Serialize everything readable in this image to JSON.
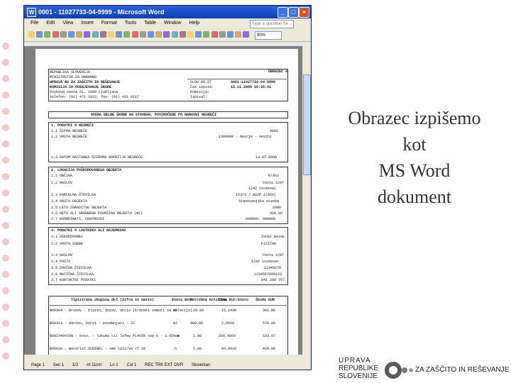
{
  "window": {
    "title": "0001 - 11027733-04-9999 - Microsoft Word",
    "word_icon": "W",
    "controls": [
      "_",
      "□",
      "×"
    ]
  },
  "menu": {
    "items": [
      "File",
      "Edit",
      "View",
      "Insert",
      "Format",
      "Tools",
      "Table",
      "Window",
      "Help"
    ],
    "ask_placeholder": "Type a question for help"
  },
  "toolbar": {
    "zoom": "90%"
  },
  "status": {
    "page": "Page 1",
    "sec": "Sec 1",
    "pages": "1/2",
    "at": "At 11cm",
    "ln": "Ln 1",
    "col": "Col 1",
    "flags": "REC TRK EXT OVR",
    "language": "Slovenian"
  },
  "document": {
    "header_lines": [
      "REPUBLIKA SLOVENIJA",
      "MINISTRSTVO ZA OBRAMBO",
      "UPRAVA RS ZA ZAŠČITO IN REŠEVANJE",
      "KOMISIJA ZA OCENJEVANJE ŠKODE",
      "Vojkova cesta 61, 1000 Ljubljana",
      "telefon: (01) 471 3322, fax: (01) 431 8117"
    ],
    "form_code": "OBRAZEC 4",
    "meta_labels": [
      "SLOG 05:57",
      "Čas izpisa:",
      "Komisija:",
      "Izpisal:"
    ],
    "meta_values": [
      "0001-11027733-04-9999",
      "15.11.2008 16:35:41"
    ],
    "main_title": "OCENA DELNE ŠKODE NA STAVBAH, POVZROČENE PO NARAVNI NESREČI",
    "sec1_title": "1. PODATKI O NESREČI",
    "sec1_rows": [
      "1.1 ŠIFRA NESREČE",
      "1.2 VRSTA NESREČE",
      "1.3 DATUM NASTANKA OZIROMA ODKRITJA NESREČE"
    ],
    "sec1_values": [
      "0001",
      "1300000 - Neurje - neviht",
      "13.07.2008"
    ],
    "sec2_title": "2. LOKACIJA POŠKODOVANEGA OBJEKTA",
    "sec2_rows": [
      "2.1 OBČINA",
      "2.2 NASLOV",
      "2.3 PARCELNA ŠTEVILKA",
      "2.4 VRSTA OBJEKTA",
      "2.5 LETO ZGRADITVE OBJEKTA",
      "2.6 NETO ALI GRADBENA POVRŠINA OBJEKTA (m2)",
      "2.7 KOORDINATI, CENTROIDI"
    ],
    "sec2_values": [
      "Krško",
      "Cesta 1C07",
      "1242 Stoževec",
      "153/3 / SDZP 1(859)",
      "Stanovanjska stavba",
      "2000",
      "420.00",
      "000000, 000000"
    ],
    "sec3_title": "3. PODATKI O LASTNIKU ALI NAJEMNIKU",
    "sec3_rows": [
      "3.1 OŠKODOVANEC",
      "3.2 VRSTA OSEBE",
      "3.3 NASLOV",
      "3.4 POŠTA",
      "3.5 DAVČNA ŠTEVILKA",
      "3.6 MATIČNA ŠTEVILKA",
      "3.7 KONTAKTNI PODATKI"
    ],
    "sec3_values": [
      "Ženez Bevak",
      "FIZIČNA",
      "Cesta 1C07",
      "1242 Stoževec",
      "12345678",
      "1234567890123",
      "041 200 707"
    ],
    "table_headers": [
      "Tipizirana skupina del (šifra in naziv)",
      "Enota mere",
      "Potrebna količina",
      "Cena Eur/enoto",
      "Škoda EUR"
    ],
    "table_rows": [
      {
        "desc": "BO0304 - Brusov - blazin, duzav, akcio (kronski zemoči na dolociju)",
        "unit": "m2",
        "qty": "20.00",
        "price": "15,1430",
        "dmg": "302.86"
      },
      {
        "desc": "BO0313 - darovo, borvi - posdanjati - ZC",
        "unit": "m2",
        "qty": "800.00",
        "price": "2,0910",
        "dmg": "570.00"
      },
      {
        "desc": "BO02340420N - kosz. - lukuma cil lsfeu  PLAOIR  top 0 - 3.85 cm",
        "unit": "kos",
        "qty": "2.00",
        "price": "266,9869",
        "dmg": "533.97"
      },
      {
        "desc": "BO0930 - material SCHIBEL - sme tali/va cl 16",
        "unit": "h",
        "qty": "5.00",
        "price": "84,0010",
        "dmg": "420.00"
      }
    ]
  },
  "slide_title": [
    "Obrazec izpišemo",
    "kot",
    "MS Word",
    "dokument"
  ],
  "logo": {
    "lines": [
      "UPRAVA",
      "REPUBLIKE",
      "SLOVENIJE"
    ],
    "tagline": "ZA ZAŠČITO IN REŠEVANJE"
  }
}
